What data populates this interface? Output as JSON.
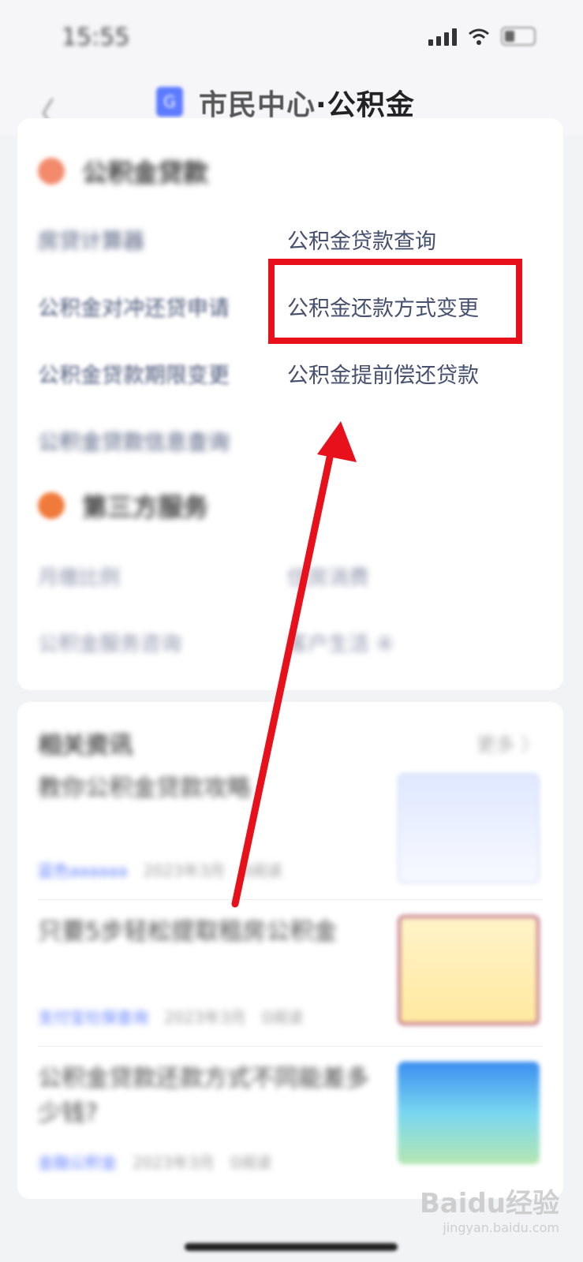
{
  "status_bar": {
    "time": "15:55"
  },
  "header": {
    "title_prefix": "市民中心",
    "title_sep": "·",
    "title_main": "公积金",
    "mini_logo": "G"
  },
  "loan_section": {
    "title": "公积金贷款",
    "left_items": [
      "房贷计算器",
      "公积金对冲还贷申请",
      "公积金贷款期限变更",
      "公积金贷款信息查询"
    ],
    "right_items": [
      "公积金贷款查询",
      "公积金还款方式变更",
      "公积金提前偿还贷款"
    ]
  },
  "third_party": {
    "title": "第三方服务",
    "rows": [
      {
        "left": "月缴比例",
        "right": "住房消费"
      },
      {
        "left": "公积金服务咨询",
        "right": "客户生活 ④"
      }
    ]
  },
  "news": {
    "header": "相关资讯",
    "more": "更多 〉",
    "items": [
      {
        "title": "教你公积金贷款攻略",
        "source": "蓝色aaaaaa",
        "date": "2023年3月",
        "views": "0阅读"
      },
      {
        "title": "只要5步轻松提取租房公积金",
        "source": "支付宝社保查询",
        "date": "2023年3月",
        "views": "0阅读"
      },
      {
        "title": "公积金贷款还款方式不同能差多少钱?",
        "source": "金融公积金",
        "date": "2023年3月",
        "views": "0阅读"
      }
    ]
  },
  "watermark": {
    "brand": "Baidu经验",
    "url": "jingyan.baidu.com"
  },
  "colors": {
    "highlight": "#e8101a",
    "accent": "#5d7bff",
    "link_text": "#47506f"
  }
}
